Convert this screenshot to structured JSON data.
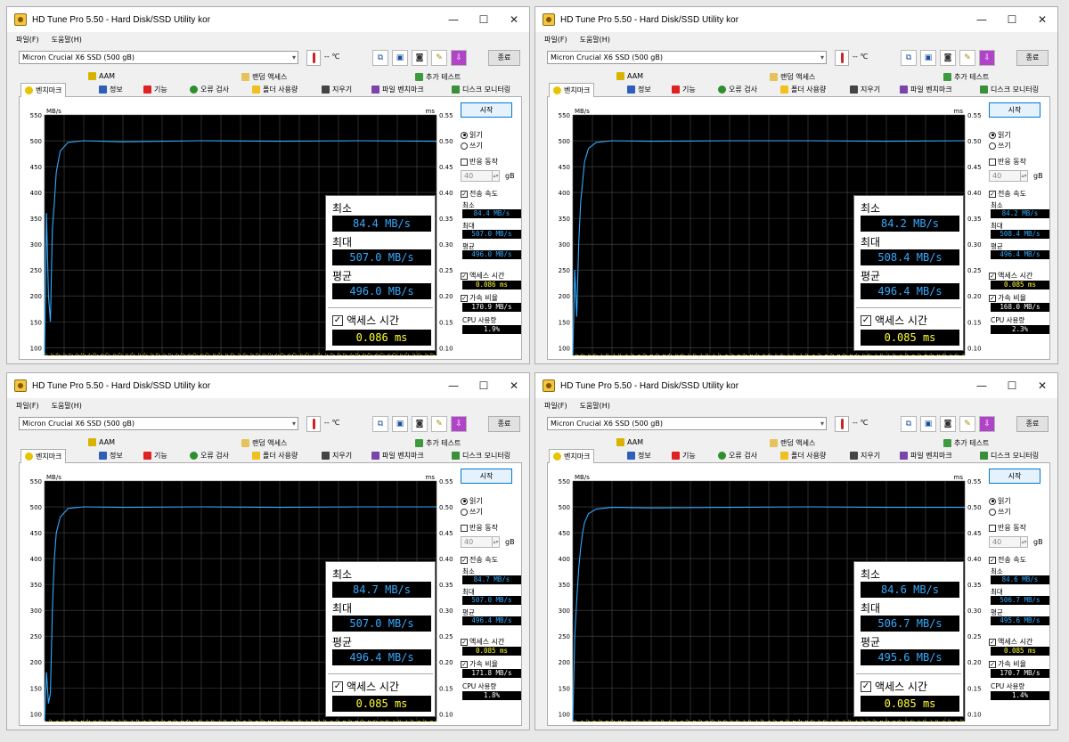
{
  "app": {
    "title": "HD Tune Pro 5.50 - Hard Disk/SSD Utility kor",
    "menu": [
      "파일(F)",
      "도움말(H)"
    ],
    "drive": "Micron  Crucial X6 SSD (500 gB)",
    "temp": "-- ℃",
    "exit_label": "종료",
    "tabs_top": [
      "AAM",
      "랜덤 액세스",
      "추가 테스트"
    ],
    "tabs_bottom": [
      "벤치마크",
      "정보",
      "기능",
      "오류 검사",
      "폴더 사용량",
      "지우기",
      "파일 벤치마크",
      "디스크 모니터링"
    ],
    "window_buttons": {
      "min": "—",
      "max": "☐",
      "close": "✕"
    },
    "controls": {
      "start": "시작",
      "read": "읽기",
      "write": "쓰기",
      "short_stroke": "반응 동작",
      "size": "40",
      "gb": "gB",
      "transfer_rate": "전송 속도",
      "min": "최소",
      "max": "최대",
      "avg": "평균",
      "access_time": "액세스 시간",
      "burst_rate": "가속 비율",
      "cpu_usage": "CPU 사용량"
    },
    "icons": {
      "app": "hdtune-app-icon",
      "thermo": "thermometer-icon",
      "tools": [
        "copy-icon",
        "copy-alt-icon",
        "camera-icon",
        "wrench-icon",
        "download-icon"
      ]
    },
    "colors": {
      "plot_bg": "#000000",
      "grid": "#4a4a4a",
      "transfer": "#33aaff",
      "access": "#ffff33"
    }
  },
  "windows": [
    {
      "results": {
        "min": "84.4 MB/s",
        "max": "507.0 MB/s",
        "avg": "496.0 MB/s",
        "access": "0.086 ms",
        "burst": "170.9 MB/s",
        "cpu": "1.9%"
      }
    },
    {
      "results": {
        "min": "84.2 MB/s",
        "max": "508.4 MB/s",
        "avg": "496.4 MB/s",
        "access": "0.085 ms",
        "burst": "168.0 MB/s",
        "cpu": "2.3%"
      }
    },
    {
      "results": {
        "min": "84.7 MB/s",
        "max": "507.0 MB/s",
        "avg": "496.4 MB/s",
        "access": "0.085 ms",
        "burst": "171.8 MB/s",
        "cpu": "1.8%"
      }
    },
    {
      "results": {
        "min": "84.6 MB/s",
        "max": "506.7 MB/s",
        "avg": "495.6 MB/s",
        "access": "0.085 ms",
        "burst": "170.7 MB/s",
        "cpu": "1.4%"
      }
    }
  ],
  "chart_data": [
    {
      "type": "line",
      "ylabel": "MB/s",
      "y2label": "ms",
      "yticks": [
        100,
        150,
        200,
        250,
        300,
        350,
        400,
        450,
        500,
        550
      ],
      "y2ticks": [
        "0.10",
        "0.15",
        "0.20",
        "0.25",
        "0.30",
        "0.35",
        "0.40",
        "0.45",
        "0.50",
        "0.55"
      ],
      "ylim": [
        85,
        550
      ],
      "y2lim": [
        0.085,
        0.55
      ],
      "grid": true,
      "series": [
        {
          "x": [
            0,
            0.5,
            1,
            1.5,
            2,
            2.5,
            3,
            4,
            6,
            10,
            20,
            40,
            60,
            80,
            100
          ],
          "values": [
            85,
            360,
            200,
            150,
            330,
            380,
            440,
            480,
            497,
            500,
            498,
            500,
            499,
            500,
            499
          ]
        },
        {
          "x": [
            0,
            100
          ],
          "values": [
            0.086,
            0.086
          ]
        }
      ]
    },
    {
      "type": "line",
      "ylabel": "MB/s",
      "y2label": "ms",
      "yticks": [
        100,
        150,
        200,
        250,
        300,
        350,
        400,
        450,
        500,
        550
      ],
      "y2ticks": [
        "0.10",
        "0.15",
        "0.20",
        "0.25",
        "0.30",
        "0.35",
        "0.40",
        "0.45",
        "0.50",
        "0.55"
      ],
      "ylim": [
        85,
        550
      ],
      "y2lim": [
        0.085,
        0.55
      ],
      "grid": true,
      "series": [
        {
          "x": [
            0,
            0.5,
            1,
            1.5,
            2,
            2.5,
            3,
            4,
            6,
            10,
            20,
            40,
            60,
            80,
            100
          ],
          "values": [
            85,
            250,
            160,
            300,
            380,
            420,
            460,
            485,
            497,
            500,
            499,
            500,
            500,
            499,
            500
          ]
        },
        {
          "x": [
            0,
            100
          ],
          "values": [
            0.085,
            0.085
          ]
        }
      ]
    },
    {
      "type": "line",
      "ylabel": "MB/s",
      "y2label": "ms",
      "yticks": [
        100,
        150,
        200,
        250,
        300,
        350,
        400,
        450,
        500,
        550
      ],
      "y2ticks": [
        "0.10",
        "0.15",
        "0.20",
        "0.25",
        "0.30",
        "0.35",
        "0.40",
        "0.45",
        "0.50",
        "0.55"
      ],
      "ylim": [
        85,
        550
      ],
      "y2lim": [
        0.085,
        0.55
      ],
      "grid": true,
      "series": [
        {
          "x": [
            0,
            0.5,
            1,
            1.5,
            2,
            2.5,
            3,
            4,
            6,
            10,
            20,
            40,
            60,
            80,
            100
          ],
          "values": [
            85,
            180,
            120,
            140,
            300,
            400,
            450,
            480,
            497,
            500,
            499,
            500,
            499,
            500,
            500
          ]
        },
        {
          "x": [
            0,
            100
          ],
          "values": [
            0.085,
            0.085
          ]
        }
      ]
    },
    {
      "type": "line",
      "ylabel": "MB/s",
      "y2label": "ms",
      "yticks": [
        100,
        150,
        200,
        250,
        300,
        350,
        400,
        450,
        500,
        550
      ],
      "y2ticks": [
        "0.10",
        "0.15",
        "0.20",
        "0.25",
        "0.30",
        "0.35",
        "0.40",
        "0.45",
        "0.50",
        "0.55"
      ],
      "ylim": [
        85,
        550
      ],
      "y2lim": [
        0.085,
        0.55
      ],
      "grid": true,
      "series": [
        {
          "x": [
            0,
            0.5,
            1,
            1.5,
            2,
            2.5,
            3,
            4,
            6,
            10,
            20,
            40,
            60,
            80,
            100
          ],
          "values": [
            85,
            250,
            320,
            380,
            420,
            450,
            470,
            487,
            496,
            499,
            498,
            499,
            500,
            499,
            499
          ]
        },
        {
          "x": [
            0,
            100
          ],
          "values": [
            0.085,
            0.085
          ]
        }
      ]
    }
  ]
}
